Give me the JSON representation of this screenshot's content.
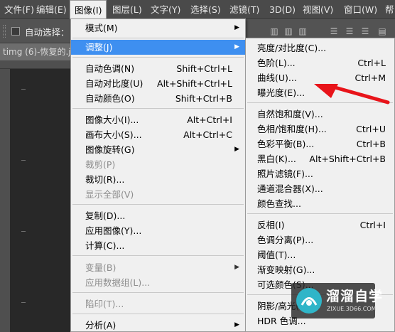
{
  "menubar": {
    "items": [
      "文件(F)",
      "编辑(E)",
      "图像(I)",
      "图层(L)",
      "文字(Y)",
      "选择(S)",
      "滤镜(T)",
      "3D(D)",
      "视图(V)",
      "窗口(W)",
      "帮"
    ]
  },
  "optbar": {
    "auto_select": "自动选择："
  },
  "doc_tab": {
    "title": "timg (6)-恢复的.jp"
  },
  "image_menu": {
    "items": [
      {
        "label": "模式(M)",
        "shortcut": "",
        "submenu": true
      },
      {
        "label": "调整(J)",
        "shortcut": "",
        "submenu": true,
        "highlighted": true
      },
      {
        "label": "自动色调(N)",
        "shortcut": "Shift+Ctrl+L"
      },
      {
        "label": "自动对比度(U)",
        "shortcut": "Alt+Shift+Ctrl+L"
      },
      {
        "label": "自动颜色(O)",
        "shortcut": "Shift+Ctrl+B"
      },
      {
        "label": "图像大小(I)...",
        "shortcut": "Alt+Ctrl+I"
      },
      {
        "label": "画布大小(S)...",
        "shortcut": "Alt+Ctrl+C"
      },
      {
        "label": "图像旋转(G)",
        "shortcut": "",
        "submenu": true
      },
      {
        "label": "裁剪(P)",
        "shortcut": "",
        "disabled": true
      },
      {
        "label": "裁切(R)...",
        "shortcut": ""
      },
      {
        "label": "显示全部(V)",
        "shortcut": "",
        "disabled": true
      },
      {
        "label": "复制(D)...",
        "shortcut": ""
      },
      {
        "label": "应用图像(Y)...",
        "shortcut": ""
      },
      {
        "label": "计算(C)...",
        "shortcut": ""
      },
      {
        "label": "变量(B)",
        "shortcut": "",
        "submenu": true,
        "disabled": true
      },
      {
        "label": "应用数据组(L)...",
        "shortcut": "",
        "disabled": true
      },
      {
        "label": "陷印(T)...",
        "shortcut": "",
        "disabled": true
      },
      {
        "label": "分析(A)",
        "shortcut": "",
        "submenu": true
      }
    ]
  },
  "adjust_submenu": {
    "items": [
      {
        "label": "亮度/对比度(C)...",
        "shortcut": ""
      },
      {
        "label": "色阶(L)...",
        "shortcut": "Ctrl+L"
      },
      {
        "label": "曲线(U)...",
        "shortcut": "Ctrl+M"
      },
      {
        "label": "曝光度(E)...",
        "shortcut": ""
      },
      {
        "label": "自然饱和度(V)...",
        "shortcut": ""
      },
      {
        "label": "色相/饱和度(H)...",
        "shortcut": "Ctrl+U"
      },
      {
        "label": "色彩平衡(B)...",
        "shortcut": "Ctrl+B"
      },
      {
        "label": "黑白(K)...",
        "shortcut": "Alt+Shift+Ctrl+B"
      },
      {
        "label": "照片滤镜(F)...",
        "shortcut": ""
      },
      {
        "label": "通道混合器(X)...",
        "shortcut": ""
      },
      {
        "label": "颜色查找...",
        "shortcut": ""
      },
      {
        "label": "反相(I)",
        "shortcut": "Ctrl+I"
      },
      {
        "label": "色调分离(P)...",
        "shortcut": ""
      },
      {
        "label": "阈值(T)...",
        "shortcut": ""
      },
      {
        "label": "渐变映射(G)...",
        "shortcut": ""
      },
      {
        "label": "可选颜色(S)...",
        "shortcut": ""
      },
      {
        "label": "阴影/高光(W)...",
        "shortcut": ""
      },
      {
        "label": "HDR 色调...",
        "shortcut": ""
      }
    ]
  },
  "watermark": {
    "title": "溜溜自学",
    "url": "ZIXUE.3D66.COM"
  },
  "colors": {
    "highlight": "#3e8ff0",
    "annotation_arrow": "#e8141a",
    "menu_bg": "#f0f0f0",
    "menubar_bg": "#4a4a4a"
  }
}
